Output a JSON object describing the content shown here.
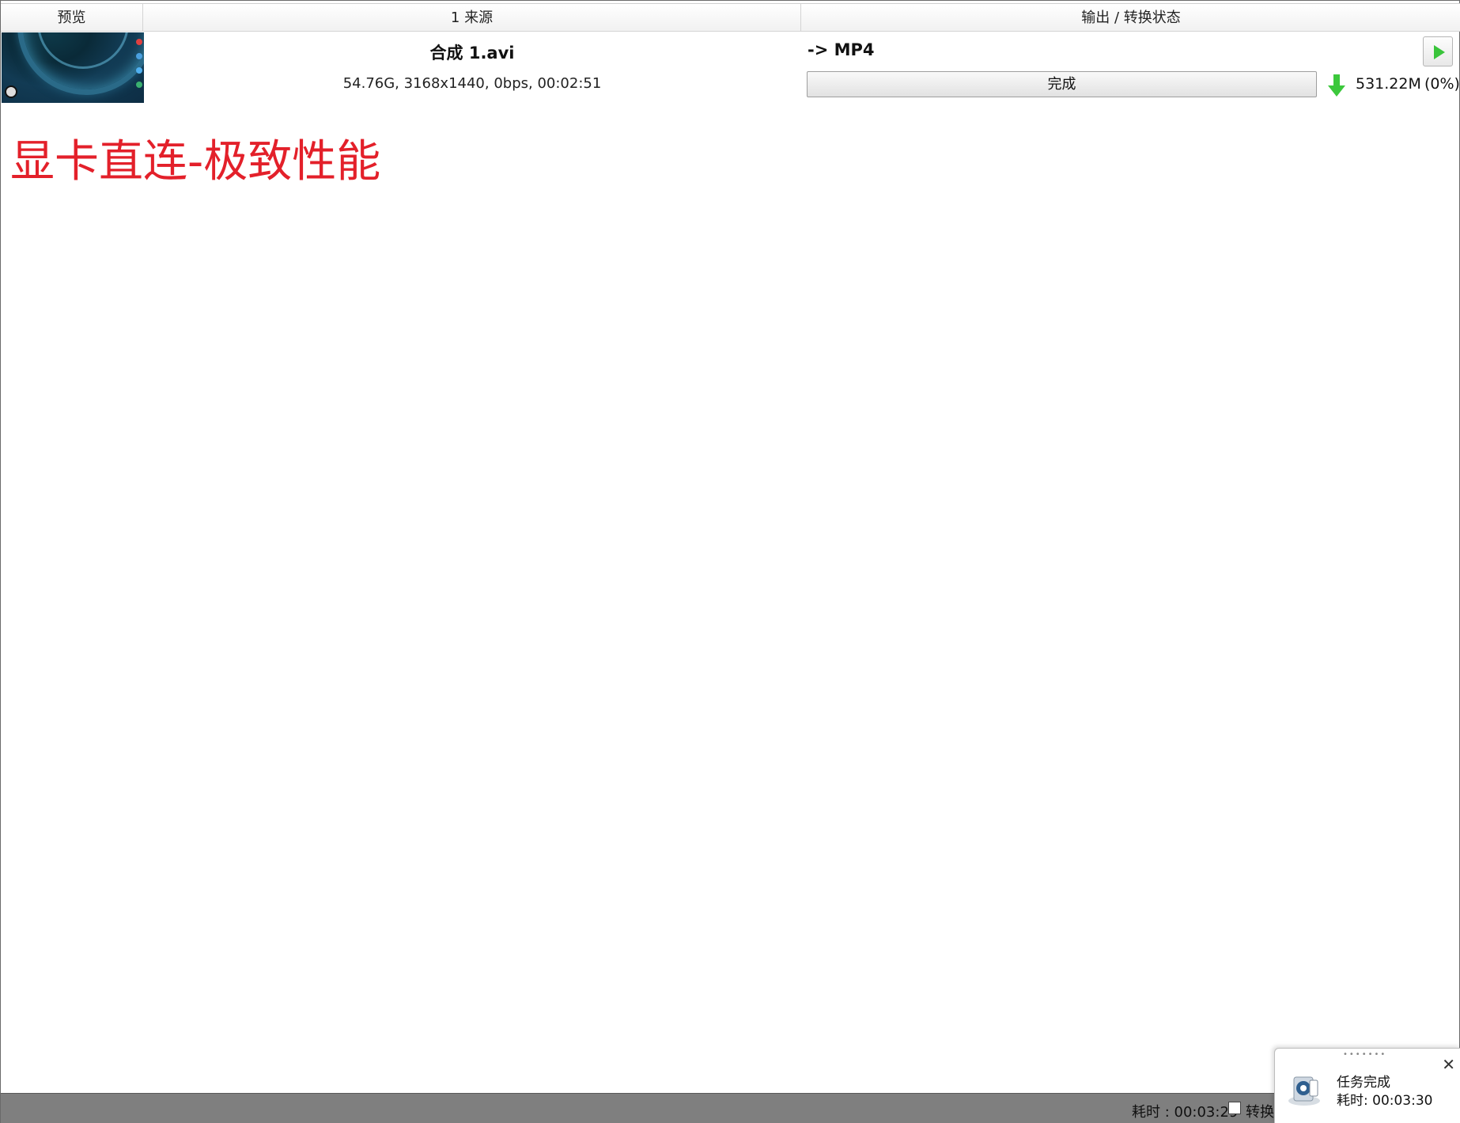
{
  "header": {
    "col_preview": "预览",
    "col_source": "1 来源",
    "col_output": "输出 / 转换状态"
  },
  "task": {
    "source_name": "合成 1.avi",
    "source_meta": "54.76G, 3168x1440, 0bps, 00:02:51",
    "output_format": "-> MP4",
    "status_label": "完成",
    "output_size": "531.22M",
    "output_percent": "(0%)",
    "play_icon": "play-icon",
    "download_icon": "down-arrow-icon"
  },
  "promo_text": "显卡直连-极致性能",
  "statusbar": {
    "elapsed": "耗时 : 00:03:29",
    "checkbox_label": "转换"
  },
  "toast": {
    "title": "任务完成",
    "time": "耗时: 00:03:30",
    "close_glyph": "✕",
    "grip": "•••••••"
  },
  "colors": {
    "promo": "#e3202a",
    "play": "#39c43a",
    "download_arrow": "#3cc83c",
    "statusbar": "#7f7f7f"
  }
}
